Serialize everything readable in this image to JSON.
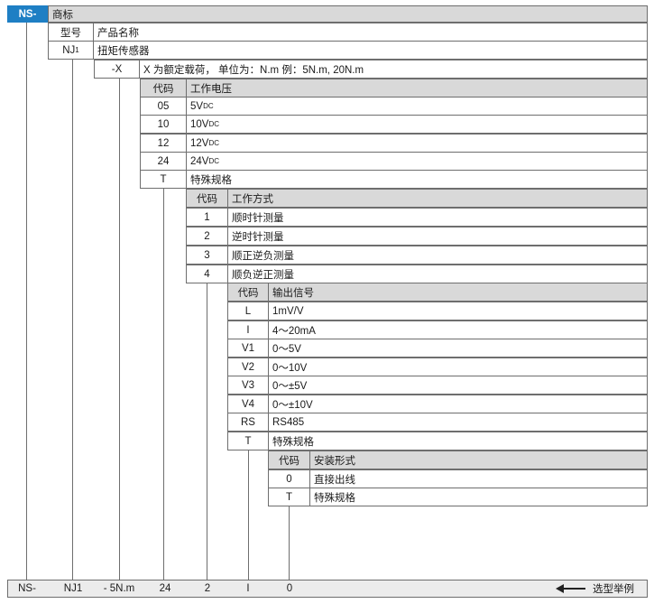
{
  "brand_code": "NS-",
  "brand_label": "商标",
  "model": {
    "header_code": "型号",
    "header_label": "产品名称",
    "code_main": "NJ",
    "code_sub": "1",
    "name": "扭矩传感器"
  },
  "range": {
    "code": "-X",
    "desc": "X 为额定载荷， 单位为：N.m 例：5N.m, 20N.m"
  },
  "voltage": {
    "header_code": "代码",
    "header_label": "工作电压",
    "rows": [
      {
        "code": "05",
        "value": "5V",
        "unit": "DC"
      },
      {
        "code": "10",
        "value": "10V",
        "unit": "DC"
      },
      {
        "code": "12",
        "value": "12V",
        "unit": "DC"
      },
      {
        "code": "24",
        "value": "24V",
        "unit": "DC"
      },
      {
        "code": "T",
        "value": "特殊规格",
        "unit": ""
      }
    ]
  },
  "mode": {
    "header_code": "代码",
    "header_label": "工作方式",
    "rows": [
      {
        "code": "1",
        "label": "顺时针测量"
      },
      {
        "code": "2",
        "label": "逆时针测量"
      },
      {
        "code": "3",
        "label": "顺正逆负测量"
      },
      {
        "code": "4",
        "label": "顺负逆正测量"
      }
    ]
  },
  "signal": {
    "header_code": "代码",
    "header_label": "输出信号",
    "rows": [
      {
        "code": "L",
        "label": "1mV/V"
      },
      {
        "code": "I",
        "label": "4～20mA"
      },
      {
        "code": "V1",
        "label": "0～5V"
      },
      {
        "code": "V2",
        "label": "0～10V"
      },
      {
        "code": "V3",
        "label": "0～±5V"
      },
      {
        "code": "V4",
        "label": "0～±10V"
      },
      {
        "code": "RS",
        "label": "RS485"
      },
      {
        "code": "T",
        "label": "特殊规格"
      }
    ]
  },
  "mount": {
    "header_code": "代码",
    "header_label": "安装形式",
    "rows": [
      {
        "code": "0",
        "label": "直接出线"
      },
      {
        "code": "T",
        "label": "特殊规格"
      }
    ]
  },
  "example": {
    "parts": [
      "NS-",
      "NJ1",
      "- 5N.m",
      "24",
      "2",
      "I",
      "0"
    ],
    "label": "选型举例"
  }
}
